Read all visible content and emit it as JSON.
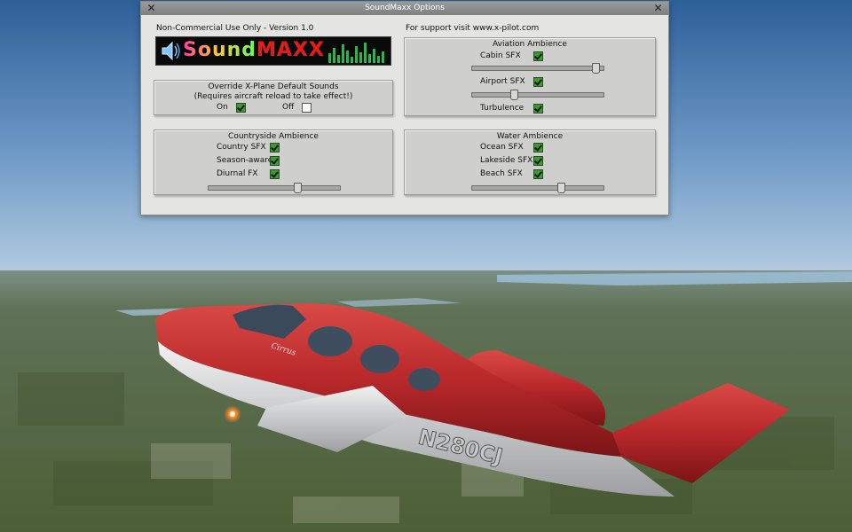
{
  "dialog": {
    "title": "SoundMaxx Options",
    "close_glyph": "✕",
    "version_text": "Non-Commercial Use Only - Version 1.0",
    "support_text": "For support visit www.x-pilot.com",
    "logo": {
      "part1": "Sound",
      "part2": "MAXX"
    }
  },
  "override": {
    "title_line1": "Override X-Plane Default Sounds",
    "title_line2": "(Requires aircraft reload to take effect!)",
    "on_label": "On",
    "on_checked": true,
    "off_label": "Off",
    "off_checked": false
  },
  "aviation": {
    "title": "Aviation Ambience",
    "cabin_label": "Cabin SFX",
    "cabin_checked": true,
    "cabin_volume": 0.97,
    "airport_label": "Airport SFX",
    "airport_checked": true,
    "airport_volume": 0.31,
    "turbulence_label": "Turbulence",
    "turbulence_checked": true
  },
  "countryside": {
    "title": "Countryside Ambience",
    "country_label": "Country SFX",
    "country_checked": true,
    "season_label": "Season-aware",
    "season_checked": true,
    "diurnal_label": "Diurnal FX",
    "diurnal_checked": true,
    "volume": 0.69
  },
  "water": {
    "title": "Water Ambience",
    "ocean_label": "Ocean SFX",
    "ocean_checked": true,
    "lakeside_label": "Lakeside SFX",
    "lakeside_checked": true,
    "beach_label": "Beach SFX",
    "beach_checked": true,
    "volume": 0.69
  },
  "aircraft": {
    "registration": "N280CJ",
    "brand": "Cirrus"
  },
  "colors": {
    "airframe": "#b8282a",
    "checkbox_on": "#3b9b2f",
    "panel": "#cfcfcd"
  }
}
